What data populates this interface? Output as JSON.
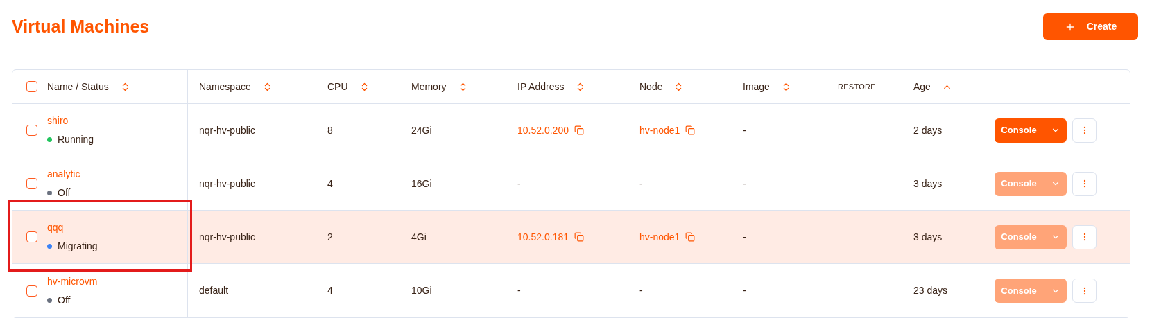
{
  "title": "Virtual Machines",
  "create_button": {
    "label": "Create"
  },
  "table": {
    "all_checked": false,
    "columns": [
      {
        "label": "Name / Status",
        "sortable": true,
        "sorted": false
      },
      {
        "label": "Namespace",
        "sortable": true,
        "sorted": false
      },
      {
        "label": "CPU",
        "sortable": true,
        "sorted": false
      },
      {
        "label": "Memory",
        "sortable": true,
        "sorted": false
      },
      {
        "label": "IP Address",
        "sortable": true,
        "sorted": false
      },
      {
        "label": "Node",
        "sortable": true,
        "sorted": false
      },
      {
        "label": "Image",
        "sortable": true,
        "sorted": false
      },
      {
        "label": "RESTORE",
        "sortable": false
      },
      {
        "label": "Age",
        "sortable": true,
        "sorted": true
      }
    ],
    "rows": [
      {
        "name": "shiro",
        "status": "Running",
        "color": "#22c55e",
        "namespace": "nqr-hv-public",
        "cpu": "8",
        "memory": "24Gi",
        "ip": {
          "text": "10.52.0.200",
          "copyable": true
        },
        "node": {
          "text": "hv-node1",
          "copyable": true
        },
        "image": "-",
        "age": "2 days",
        "console": {
          "label": "Console",
          "disabled": false
        },
        "checked": false,
        "highlighted": false,
        "outlined": false
      },
      {
        "name": "analytic",
        "status": "Off",
        "color": "#6b7280",
        "namespace": "nqr-hv-public",
        "cpu": "4",
        "memory": "16Gi",
        "ip": {
          "text": "-",
          "copyable": false
        },
        "node": {
          "text": "-",
          "copyable": false
        },
        "image": "-",
        "age": "3 days",
        "console": {
          "label": "Console",
          "disabled": true
        },
        "checked": false,
        "highlighted": false,
        "outlined": false
      },
      {
        "name": "qqq",
        "status": "Migrating",
        "color": "#3b82f6",
        "namespace": "nqr-hv-public",
        "cpu": "2",
        "memory": "4Gi",
        "ip": {
          "text": "10.52.0.181",
          "copyable": true
        },
        "node": {
          "text": "hv-node1",
          "copyable": true
        },
        "image": "-",
        "age": "3 days",
        "console": {
          "label": "Console",
          "disabled": true
        },
        "checked": false,
        "highlighted": true,
        "outlined": true
      },
      {
        "name": "hv-microvm",
        "status": "Off",
        "color": "#6b7280",
        "namespace": "default",
        "cpu": "4",
        "memory": "10Gi",
        "ip": {
          "text": "-",
          "copyable": false
        },
        "node": {
          "text": "-",
          "copyable": false
        },
        "image": "-",
        "age": "23 days",
        "console": {
          "label": "Console",
          "disabled": true
        },
        "checked": false,
        "highlighted": false,
        "outlined": false
      }
    ]
  }
}
